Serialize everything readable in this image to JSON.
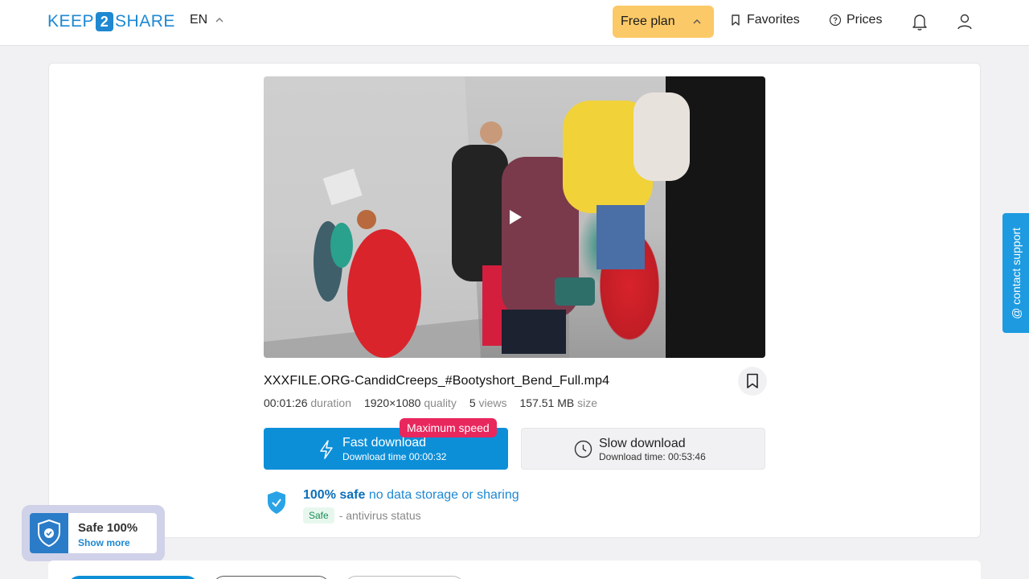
{
  "header": {
    "logo_left": "KEEP",
    "logo_num": "2",
    "logo_right": "SHARE",
    "lang": "EN",
    "plan_label": "Free plan",
    "favorites_label": "Favorites",
    "prices_label": "Prices"
  },
  "file": {
    "name": "XXXFILE.ORG-CandidCreeps_#Bootyshort_Bend_Full.mp4",
    "duration": "00:01:26",
    "duration_label": "duration",
    "quality": "1920×1080",
    "quality_label": "quality",
    "views": "5",
    "views_label": "views",
    "size": "157.51 MB",
    "size_label": "size"
  },
  "download": {
    "badge": "Maximum speed",
    "fast_label": "Fast download",
    "fast_time": "Download time 00:00:32",
    "slow_label": "Slow download",
    "slow_time": "Download time: 00:53:46"
  },
  "safety": {
    "bold": "100% safe",
    "text": "no data storage or sharing",
    "tag": "Safe",
    "status": "- antivirus status"
  },
  "widget": {
    "title": "Safe 100%",
    "link": "Show more"
  },
  "support": {
    "label": "@ contact support"
  },
  "colors": {
    "accent": "#0d8fd8",
    "plan": "#fcc968",
    "badge": "#e8275d"
  }
}
